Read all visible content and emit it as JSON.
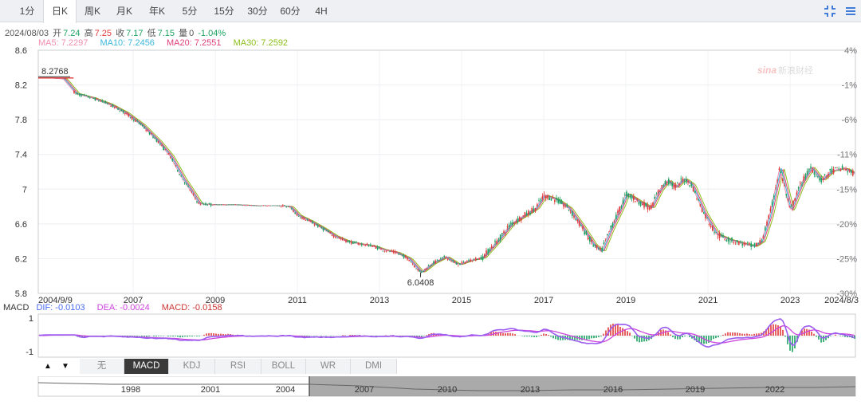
{
  "tabs": [
    {
      "label": "1分",
      "active": false
    },
    {
      "label": "日K",
      "active": true
    },
    {
      "label": "周K",
      "active": false
    },
    {
      "label": "月K",
      "active": false
    },
    {
      "label": "年K",
      "active": false
    },
    {
      "label": "5分",
      "active": false
    },
    {
      "label": "15分",
      "active": false
    },
    {
      "label": "30分",
      "active": false
    },
    {
      "label": "60分",
      "active": false
    },
    {
      "label": "4H",
      "active": false
    }
  ],
  "toolbar": {
    "compress_icon": "compress-arrows-icon",
    "menu_icon": "menu-icon"
  },
  "quote": {
    "date": "2024/08/03",
    "open_label": "开",
    "open": "7.24",
    "high_label": "高",
    "high": "7.25",
    "close_label": "收",
    "close": "7.17",
    "low_label": "低",
    "low": "7.15",
    "volume_label": "量",
    "volume": "0",
    "change": "-1.04%"
  },
  "ma": {
    "ma5": "MA5: 7.2297",
    "ma10": "MA10: 7.2456",
    "ma20": "MA20: 7.2551",
    "ma30": "MA30: 7.2592"
  },
  "watermark": "新浪财经",
  "macd_legend": {
    "title": "MACD",
    "dif": "DIF: -0.0103",
    "dea": "DEA: -0.0024",
    "macd": "MACD: -0.0158"
  },
  "indicator_tabs": [
    {
      "label": "无",
      "active": false
    },
    {
      "label": "MACD",
      "active": true
    },
    {
      "label": "KDJ",
      "active": false
    },
    {
      "label": "RSI",
      "active": false
    },
    {
      "label": "BOLL",
      "active": false
    },
    {
      "label": "WR",
      "active": false
    },
    {
      "label": "DMI",
      "active": false
    }
  ],
  "nav": {
    "up": "▲",
    "down": "▼",
    "years": [
      "1998",
      "2001",
      "2004",
      "2007",
      "2010",
      "2013",
      "2016",
      "2019",
      "2022"
    ]
  },
  "colors": {
    "up": "#e23a3a",
    "down": "#1aa260",
    "ma5": "#f08fb0",
    "ma10": "#3ab8d8",
    "ma20": "#e0407a",
    "ma30": "#8cbf1a",
    "dif": "#4a6cf5",
    "dea": "#cc44dd",
    "macd": "#cc3333",
    "active_tab": "#3a3a3a"
  },
  "chart_data": {
    "type": "line",
    "x_tick_labels": [
      "2004/9/9",
      "2007",
      "2009",
      "2011",
      "2013",
      "2015",
      "2017",
      "2019",
      "2021",
      "2023",
      "2024/8/3"
    ],
    "y_tick_labels": [
      "8.6",
      "8.2",
      "7.8",
      "7.4",
      "7",
      "6.6",
      "6.2",
      "5.8"
    ],
    "y_right_tick_labels": [
      "4%",
      "-1%",
      "-6%",
      "-11%",
      "-15%",
      "-20%",
      "-25%",
      "-30%"
    ],
    "ylim": [
      5.8,
      8.6
    ],
    "annotations": [
      {
        "label": "8.2768",
        "x": 2004.69,
        "y": 8.2768
      },
      {
        "label": "6.0408",
        "x": 2014.0,
        "y": 6.0408
      }
    ],
    "series": [
      {
        "x": [
          2004.69,
          2005.0,
          2005.3,
          2005.6,
          2006.0,
          2006.4,
          2006.8,
          2007.2,
          2007.6,
          2007.9,
          2008.2,
          2008.4,
          2008.6,
          2009.0,
          2009.5,
          2010.0,
          2010.5,
          2010.8,
          2011.0,
          2011.3,
          2011.6,
          2011.9,
          2012.2,
          2012.5,
          2012.8,
          2013.1,
          2013.4,
          2013.7,
          2014.0,
          2014.3,
          2014.6,
          2014.9,
          2015.2,
          2015.5,
          2015.9,
          2016.2,
          2016.5,
          2016.8,
          2017.0,
          2017.3,
          2017.6,
          2017.9,
          2018.2,
          2018.4,
          2018.6,
          2018.9,
          2019.0,
          2019.3,
          2019.6,
          2019.8,
          2020.0,
          2020.2,
          2020.4,
          2020.6,
          2020.9,
          2021.2,
          2021.5,
          2021.8,
          2022.1,
          2022.3,
          2022.5,
          2022.75,
          2023.0,
          2023.25,
          2023.5,
          2023.75,
          2024.0,
          2024.3,
          2024.59
        ],
        "values": [
          8.28,
          8.28,
          8.27,
          8.1,
          8.05,
          7.98,
          7.88,
          7.74,
          7.55,
          7.38,
          7.12,
          6.98,
          6.83,
          6.82,
          6.82,
          6.81,
          6.81,
          6.8,
          6.7,
          6.63,
          6.55,
          6.46,
          6.4,
          6.37,
          6.35,
          6.3,
          6.27,
          6.2,
          6.04,
          6.15,
          6.22,
          6.13,
          6.18,
          6.21,
          6.42,
          6.6,
          6.69,
          6.78,
          6.93,
          6.88,
          6.78,
          6.58,
          6.36,
          6.28,
          6.52,
          6.82,
          6.95,
          6.86,
          6.78,
          6.98,
          7.1,
          7.02,
          7.12,
          7.05,
          6.72,
          6.48,
          6.42,
          6.38,
          6.34,
          6.4,
          6.7,
          7.25,
          6.75,
          7.05,
          7.25,
          7.1,
          7.21,
          7.24,
          7.17
        ]
      }
    ]
  }
}
